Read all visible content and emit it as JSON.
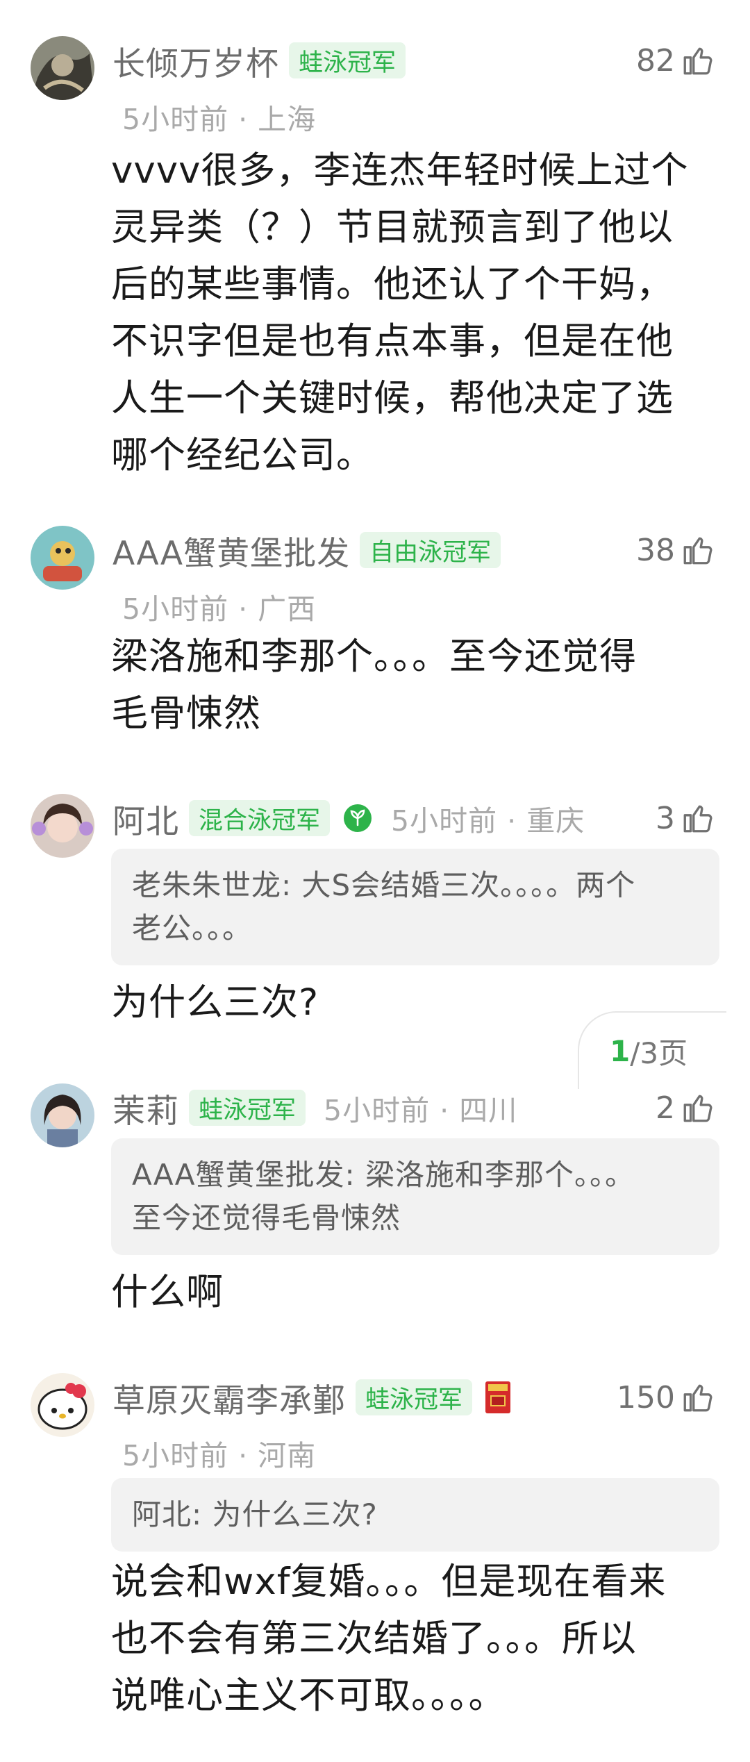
{
  "comments": [
    {
      "name": "长倾万岁杯",
      "badge": "蛙泳冠军",
      "time_loc": "5小时前 · 上海",
      "likes": "82",
      "lines": [
        "vvvv很多，李连杰年轻时候上过个",
        "灵异类（？）节目就预言到了他以",
        "后的某些事情。他还认了个干妈，",
        "不识字但是也有点本事，但是在他",
        "人生一个关键时候，帮他决定了选",
        "哪个经纪公司。"
      ]
    },
    {
      "name": "AAA蟹黄堡批发",
      "badge": "自由泳冠军",
      "time_loc": "5小时前 · 广西",
      "likes": "38",
      "lines": [
        "梁洛施和李那个。。。至今还觉得",
        "毛骨悚然"
      ]
    },
    {
      "name": "阿北",
      "badge": "混合泳冠军",
      "time_loc": "5小时前 · 重庆",
      "likes": "3",
      "quote_lines": [
        "老朱朱世龙: 大S会结婚三次。。。。两个",
        "老公。。。"
      ],
      "lines": [
        "为什么三次?"
      ]
    },
    {
      "name": "茉莉",
      "badge": "蛙泳冠军",
      "time_loc": "5小时前 · 四川",
      "likes": "2",
      "quote_lines": [
        "AAA蟹黄堡批发: 梁洛施和李那个。。。",
        "至今还觉得毛骨悚然"
      ],
      "lines": [
        "什么啊"
      ]
    },
    {
      "name": "草原灭霸李承鄞",
      "badge": "蛙泳冠军",
      "time_loc": "5小时前 · 河南",
      "likes": "150",
      "quote_lines": [
        "阿北: 为什么三次?"
      ],
      "lines": [
        "说会和wxf复婚。。。但是现在看来",
        "也不会有第三次结婚了。。。所以",
        "说唯心主义不可取。。。。"
      ]
    }
  ],
  "pager": {
    "current": "1",
    "rest": "/3页"
  },
  "colors": {
    "accent": "#2db34a",
    "badge_bg": "#e7f6e9",
    "quote_bg": "#f2f2f2"
  },
  "icons": [
    "thumb-up-icon",
    "sprout-icon",
    "book-icon"
  ]
}
